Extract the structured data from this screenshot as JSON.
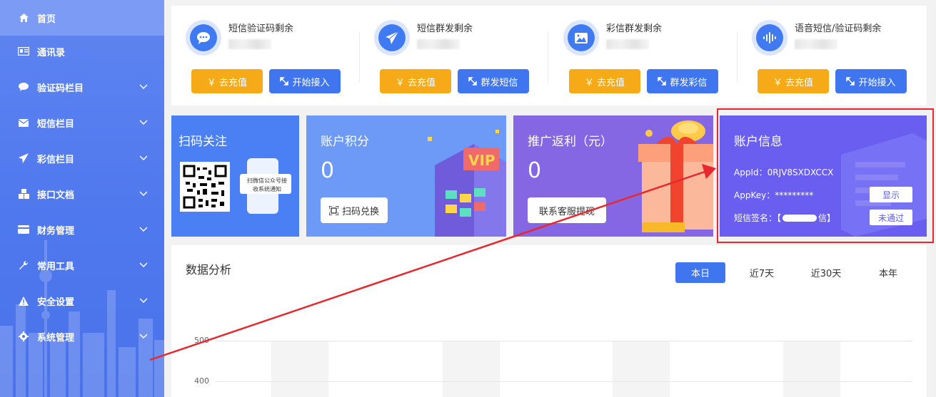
{
  "sidebar": {
    "items": [
      {
        "label": "首页",
        "icon": "home-icon",
        "active": true,
        "has_children": false
      },
      {
        "label": "通讯录",
        "icon": "address-book-icon",
        "active": false,
        "has_children": false
      },
      {
        "label": "验证码栏目",
        "icon": "chat-bubble-icon",
        "active": false,
        "has_children": true
      },
      {
        "label": "短信栏目",
        "icon": "envelope-icon",
        "active": false,
        "has_children": true
      },
      {
        "label": "彩信栏目",
        "icon": "paper-plane-icon",
        "active": false,
        "has_children": true
      },
      {
        "label": "接口文档",
        "icon": "cubes-icon",
        "active": false,
        "has_children": true
      },
      {
        "label": "财务管理",
        "icon": "credit-card-icon",
        "active": false,
        "has_children": true
      },
      {
        "label": "常用工具",
        "icon": "wrench-icon",
        "active": false,
        "has_children": true
      },
      {
        "label": "安全设置",
        "icon": "warning-icon",
        "active": false,
        "has_children": true
      },
      {
        "label": "系统管理",
        "icon": "gear-icon",
        "active": false,
        "has_children": true
      }
    ]
  },
  "stats": [
    {
      "title": "短信验证码剩余",
      "icon": "chat-dots-icon",
      "recharge_label": "￥ 去充值",
      "action_label": "开始接入"
    },
    {
      "title": "短信群发剩余",
      "icon": "paper-plane-icon",
      "recharge_label": "￥ 去充值",
      "action_label": "群发短信"
    },
    {
      "title": "彩信群发剩余",
      "icon": "image-icon",
      "recharge_label": "￥ 去充值",
      "action_label": "群发彩信"
    },
    {
      "title": "语音短信/验证码剩余",
      "icon": "voice-wave-icon",
      "recharge_label": "￥ 去充值",
      "action_label": "开始接入"
    }
  ],
  "cards": {
    "scan": {
      "title": "扫码关注",
      "qr_text": "扫微信公众号接收系统通知"
    },
    "points": {
      "title": "账户积分",
      "value": "0",
      "button": "扫码兑换",
      "badge": "VIP"
    },
    "promo": {
      "title": "推广返利（元）",
      "value": "0",
      "button": "联系客服提现"
    },
    "account": {
      "title": "账户信息",
      "appid": "AppId：0RJV8SXDXCCX",
      "appkey": "AppKey：*********",
      "signature": "短信签名：【",
      "signature_end": "信】",
      "show_button": "显示",
      "status_button": "未通过"
    }
  },
  "analysis": {
    "title": "数据分析",
    "tabs": [
      "本日",
      "近7天",
      "近30天",
      "本年"
    ],
    "active_tab": "本日",
    "y_ticks": [
      "500",
      "400"
    ]
  },
  "colors": {
    "sidebar": "#5078ee",
    "accent_blue": "#3f76f0",
    "accent_orange": "#f7aa17",
    "highlight_red": "#e8282f"
  }
}
